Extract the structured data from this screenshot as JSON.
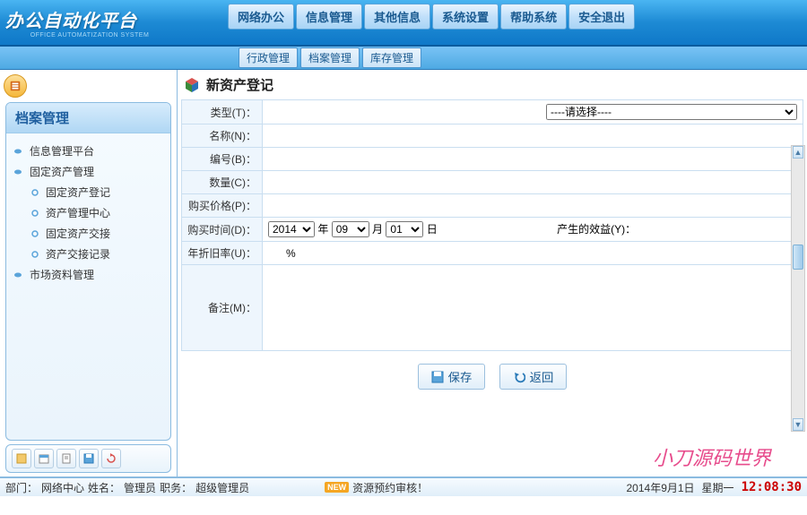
{
  "app": {
    "title": "办公自动化平台",
    "subtitle": "OFFICE AUTOMATIZATION SYSTEM"
  },
  "topnav": [
    "网络办公",
    "信息管理",
    "其他信息",
    "系统设置",
    "帮助系统",
    "安全退出"
  ],
  "subnav": [
    "行政管理",
    "档案管理",
    "库存管理"
  ],
  "sidebar": {
    "header": "档案管理",
    "items": [
      {
        "label": "信息管理平台",
        "child": false
      },
      {
        "label": "固定资产管理",
        "child": false
      },
      {
        "label": "固定资产登记",
        "child": true
      },
      {
        "label": "资产管理中心",
        "child": true
      },
      {
        "label": "固定资产交接",
        "child": true
      },
      {
        "label": "资产交接记录",
        "child": true
      },
      {
        "label": "市场资料管理",
        "child": false
      }
    ]
  },
  "page": {
    "title": "新资产登记",
    "fields": {
      "type_label": "类型(T)：",
      "type_placeholder": "----请选择----",
      "name_label": "名称(N)：",
      "code_label": "编号(B)：",
      "qty_label": "数量(C)：",
      "price_label": "购买价格(P)：",
      "date_label": "购买时间(D)：",
      "year": "2014",
      "year_suffix": "年",
      "month": "09",
      "month_suffix": "月",
      "day": "01",
      "day_suffix": "日",
      "benefit_label": "产生的效益(Y)：",
      "dep_label": "年折旧率(U)：",
      "dep_suffix": "%",
      "memo_label": "备注(M)："
    },
    "buttons": {
      "save": "保存",
      "back": "返回"
    },
    "watermark": "小刀源码世界"
  },
  "status": {
    "dept_label": "部门：",
    "dept": "网络中心",
    "name_label": "姓名：",
    "name": "管理员",
    "role_label": "职务：",
    "role": "超级管理员",
    "new": "NEW",
    "notice": "资源预约审核！",
    "date": "2014年9月1日",
    "weekday": "星期一",
    "time": "12:08:30"
  }
}
